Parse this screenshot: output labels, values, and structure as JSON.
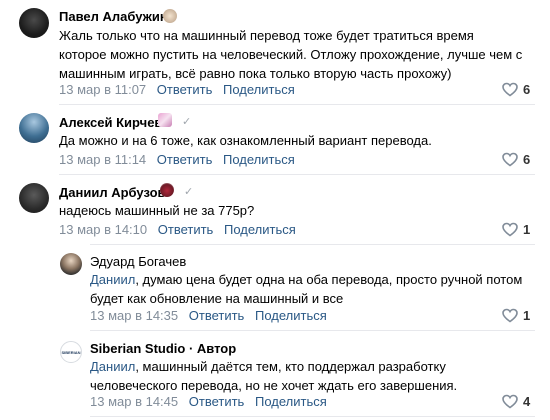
{
  "comments": [
    {
      "author": "Павел Алабужин",
      "text_lines": [
        "Жаль только что на машинный перевод тоже будет тратиться время",
        "которое можно пустить на человеческий. Отложу прохождение, лучше чем с",
        "машинным играть, всё равно пока только вторую часть прохожу)"
      ],
      "date": "13 мар в 11:07",
      "reply": "Ответить",
      "share": "Поделиться",
      "likes": "6"
    },
    {
      "author": "Алексей Кирчев",
      "text_lines": [
        "Да можно и на 6 тоже, как ознакомленный вариант перевода."
      ],
      "date": "13 мар в 11:14",
      "reply": "Ответить",
      "share": "Поделиться",
      "likes": "6"
    },
    {
      "author": "Даниил Арбузов",
      "text_lines": [
        "надеюсь машинный не за 775р?"
      ],
      "date": "13 мар в 14:10",
      "reply": "Ответить",
      "share": "Поделиться",
      "likes": "1"
    },
    {
      "author": "Эдуард Богачев",
      "mention": "Даниил",
      "text_first": ", думаю цена будет одна на оба перевода, просто ручной потом",
      "text_second": "будет как обновление на машинный и все",
      "date": "13 мар в 14:35",
      "reply": "Ответить",
      "share": "Поделиться",
      "likes": "1"
    },
    {
      "author": "Siberian Studio · Автор",
      "avatar_text": "SIBERIAN",
      "mention": "Даниил",
      "text_first": ", машинный даётся тем, кто поддержал разработку",
      "text_second": "человеческого перевода, но не хочет ждать его завершения.",
      "date": "13 мар в 14:45",
      "reply": "Ответить",
      "share": "Поделиться",
      "likes": "4"
    }
  ],
  "verified_mark": "✓",
  "colors": {
    "link": "#2a5885",
    "meta": "#818c99",
    "divider": "#e7e8ec"
  }
}
